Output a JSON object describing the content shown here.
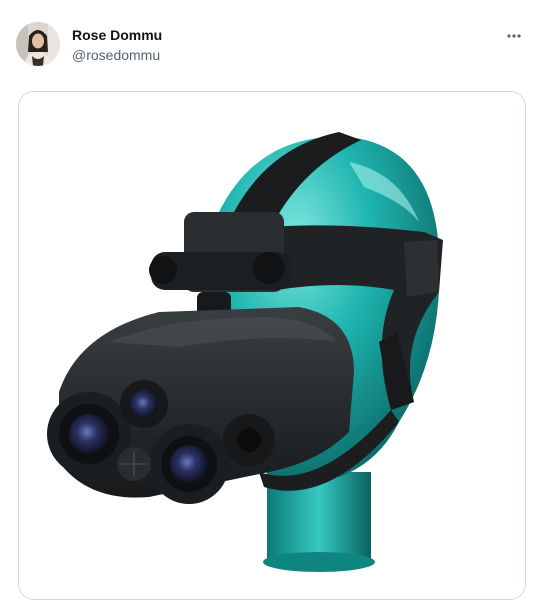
{
  "tweet": {
    "author": {
      "display_name": "Rose Dommu",
      "handle": "@rosedommu",
      "avatar_icon": "user-avatar"
    },
    "more_icon": "ellipsis-icon",
    "media": {
      "kind": "photo",
      "icon": "night-vision-goggles-on-mannequin-head"
    }
  },
  "colors": {
    "text_primary": "#0f1419",
    "text_secondary": "#536471",
    "border": "#cfd9de",
    "mannequin_teal": "#1fb5b0",
    "device_black": "#1e2123"
  }
}
